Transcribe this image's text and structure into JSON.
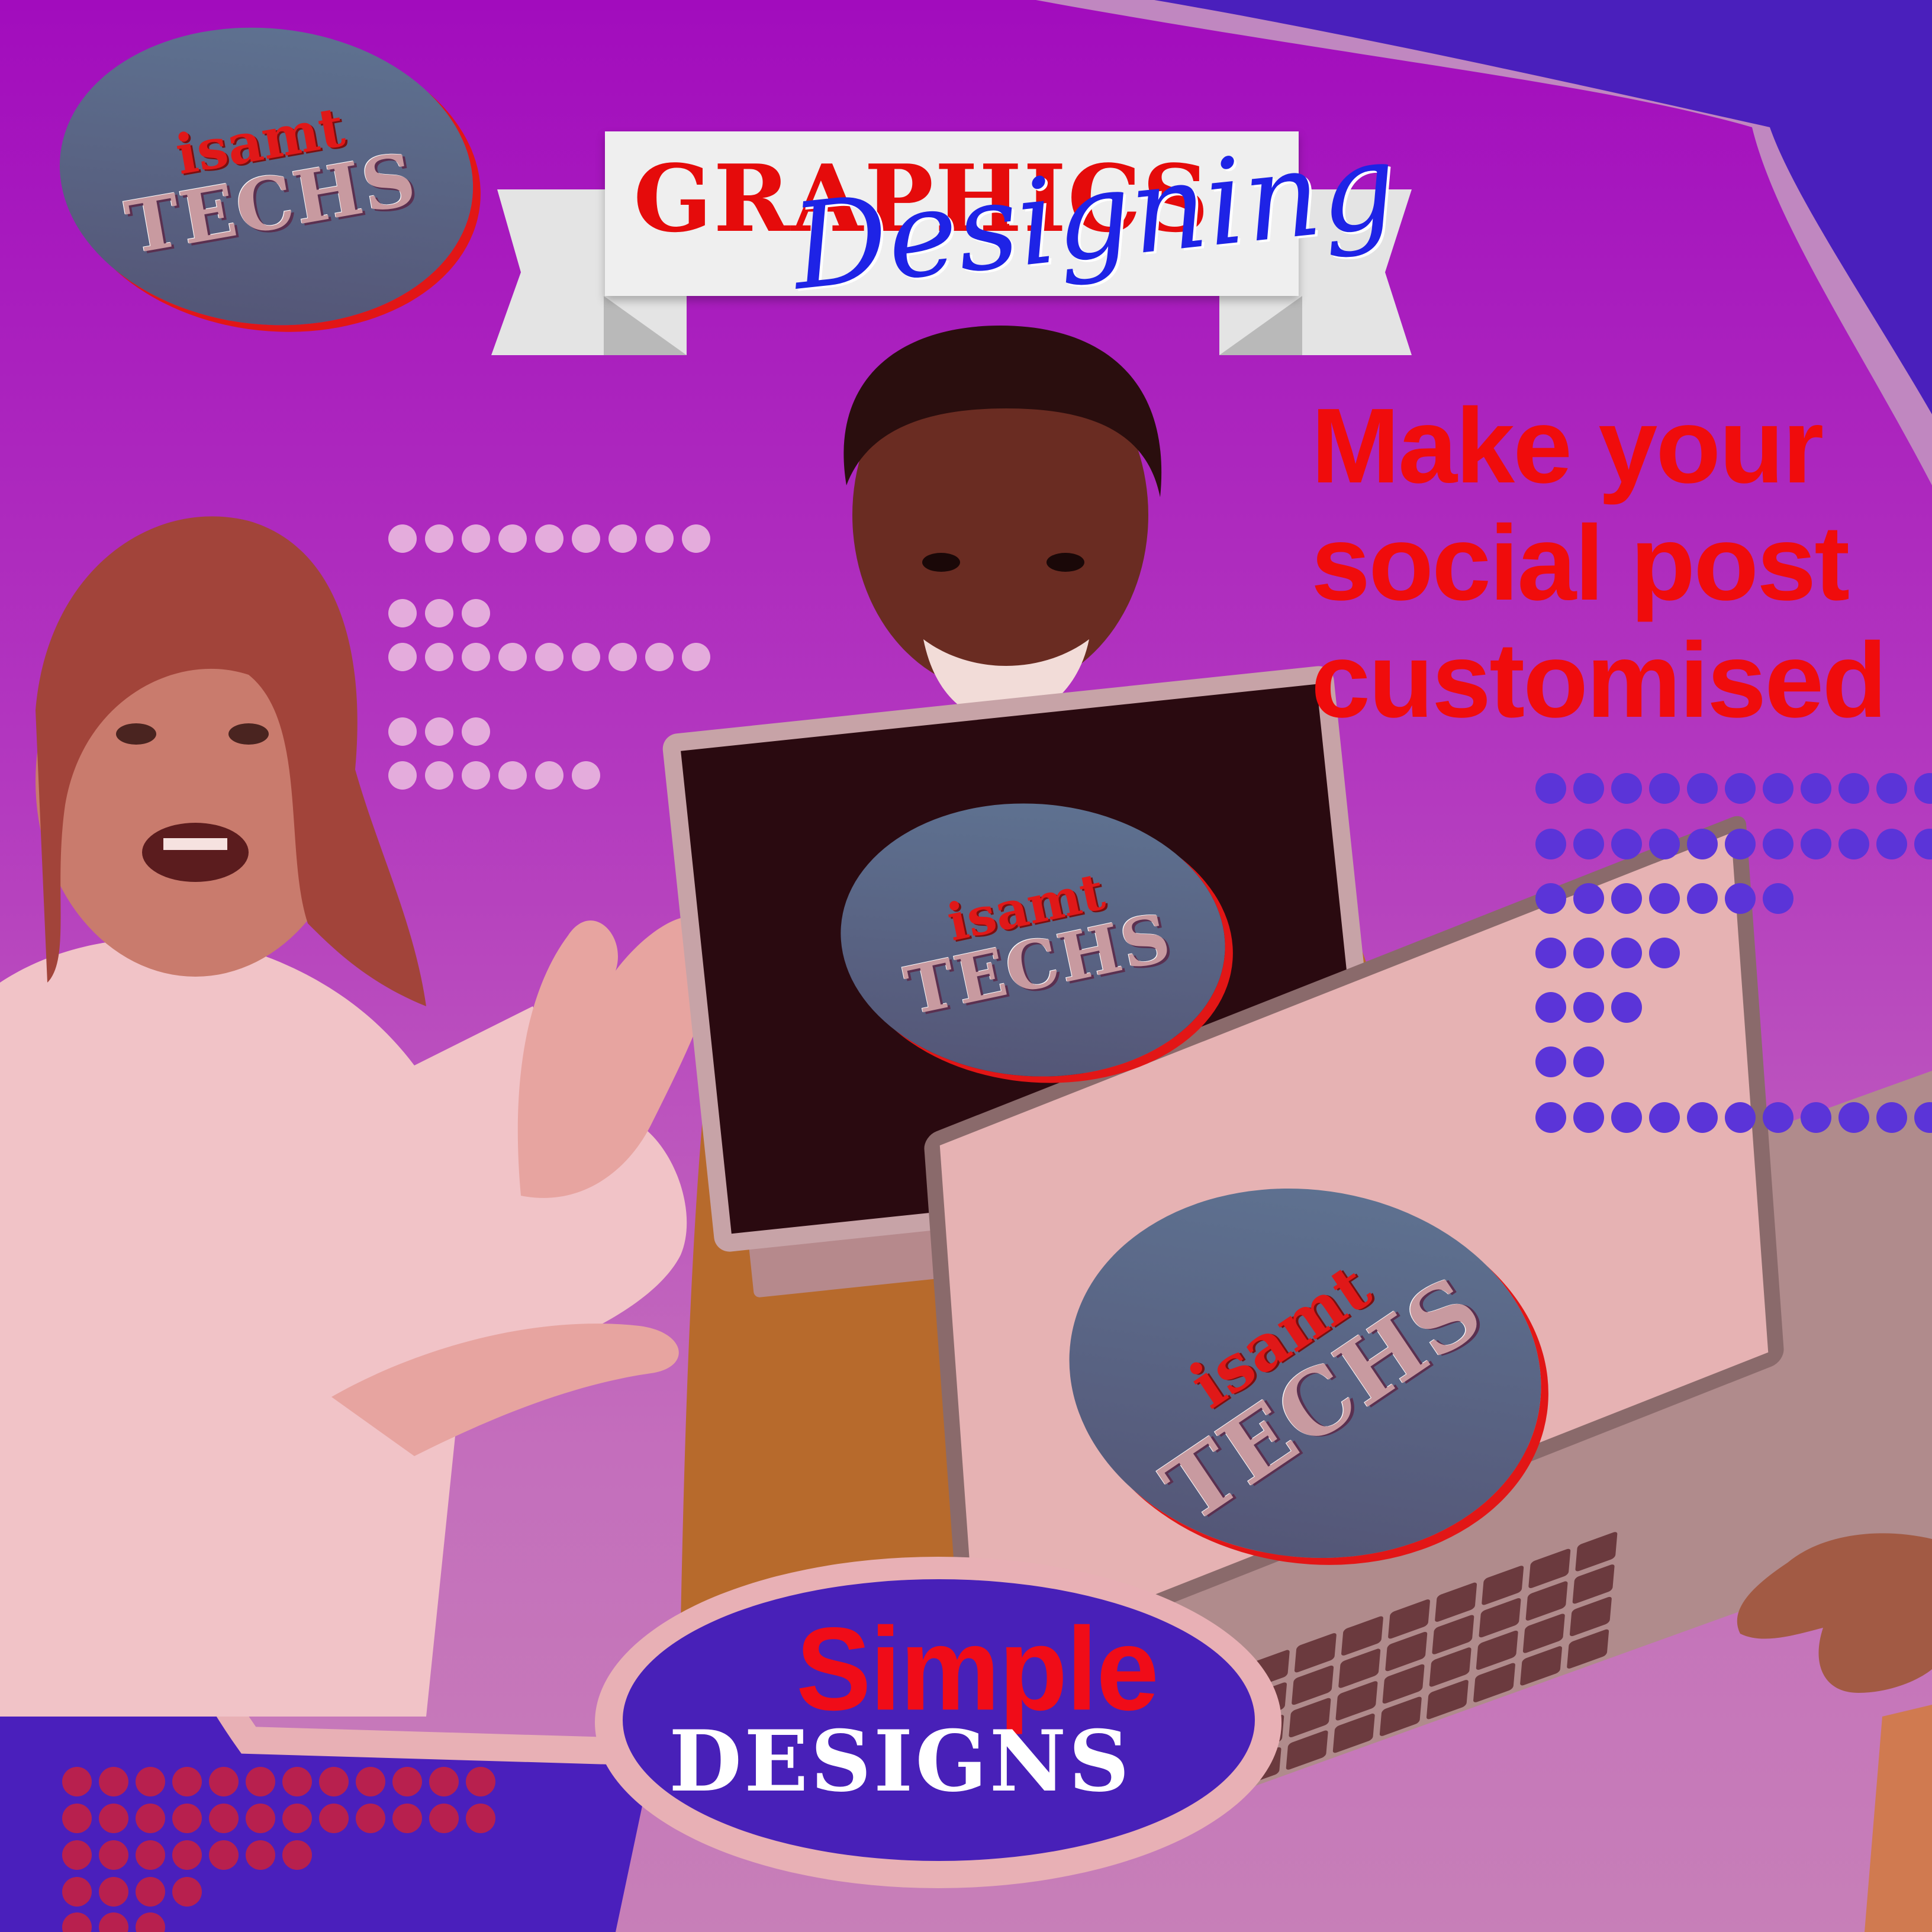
{
  "brand": {
    "logo_small": "isamt",
    "logo_big": "TECHS"
  },
  "banner": {
    "title": "GRAPHICS",
    "subtitle": "Designing"
  },
  "headline": {
    "line1": "Make your",
    "line2": "social post",
    "line3": "customised"
  },
  "bubble": {
    "line1": "Simple",
    "line2": "DESIGNS"
  },
  "colors": {
    "accent_red": "#f00c0c",
    "accent_blue": "#1e23e6",
    "purple": "#4820b8",
    "badge_fill": "#5e7190"
  }
}
